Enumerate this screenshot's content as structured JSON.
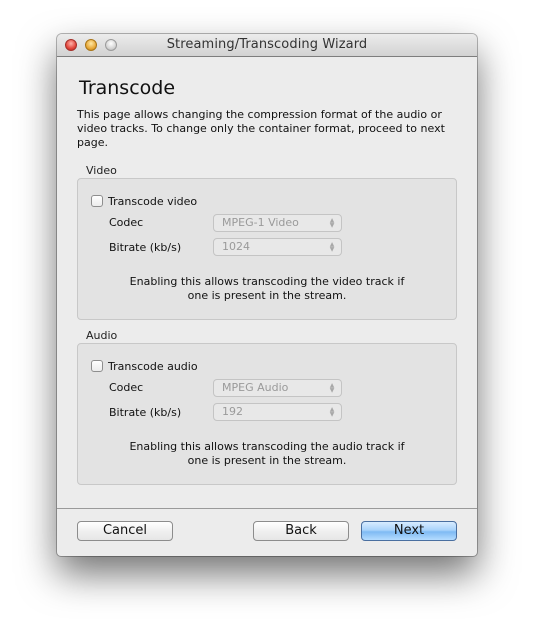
{
  "window": {
    "title": "Streaming/Transcoding Wizard",
    "controls": [
      "close",
      "minimize",
      "zoom"
    ]
  },
  "page": {
    "heading": "Transcode",
    "description": "This page allows changing the compression format of the audio or video tracks. To change only the container format, proceed to next page."
  },
  "video": {
    "group_label": "Video",
    "checkbox_label": "Transcode video",
    "checked": false,
    "codec_label": "Codec",
    "codec_value": "MPEG-1 Video",
    "bitrate_label": "Bitrate (kb/s)",
    "bitrate_value": "1024",
    "hint": "Enabling this allows transcoding the video track if one is present in the stream."
  },
  "audio": {
    "group_label": "Audio",
    "checkbox_label": "Transcode audio",
    "checked": false,
    "codec_label": "Codec",
    "codec_value": "MPEG Audio",
    "bitrate_label": "Bitrate (kb/s)",
    "bitrate_value": "192",
    "hint": "Enabling this allows transcoding the audio track if one is present in the stream."
  },
  "buttons": {
    "cancel": "Cancel",
    "back": "Back",
    "next": "Next"
  },
  "icons": {
    "select_arrows": "⌃⌄"
  },
  "colors": {
    "window_bg": "#ececec",
    "group_bg": "#e3e3e3",
    "primary_button": "#7fbaf3",
    "disabled_text": "#9a9a9a"
  }
}
